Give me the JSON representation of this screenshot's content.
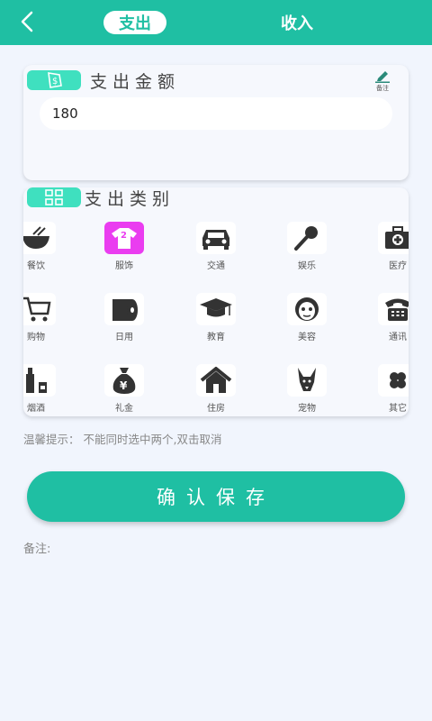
{
  "header": {
    "tabs": [
      {
        "label": "支出",
        "active": true
      },
      {
        "label": "收入",
        "active": false
      }
    ]
  },
  "amount_section": {
    "title": "支出金额",
    "remark_button_label": "备注",
    "input_value": "180"
  },
  "category_section": {
    "title": "支出类别",
    "items": [
      {
        "label": "餐饮",
        "icon": "bowl-icon",
        "selected": false
      },
      {
        "label": "服饰",
        "icon": "clothes-icon",
        "selected": true
      },
      {
        "label": "交通",
        "icon": "car-icon",
        "selected": false
      },
      {
        "label": "娱乐",
        "icon": "microphone-icon",
        "selected": false
      },
      {
        "label": "医疗",
        "icon": "medical-kit-icon",
        "selected": false
      },
      {
        "label": "购物",
        "icon": "shopping-cart-icon",
        "selected": false
      },
      {
        "label": "日用",
        "icon": "tissue-roll-icon",
        "selected": false
      },
      {
        "label": "教育",
        "icon": "graduation-cap-icon",
        "selected": false
      },
      {
        "label": "美容",
        "icon": "face-mask-icon",
        "selected": false
      },
      {
        "label": "通讯",
        "icon": "telephone-icon",
        "selected": false
      },
      {
        "label": "烟酒",
        "icon": "bottle-icon",
        "selected": false
      },
      {
        "label": "礼金",
        "icon": "money-bag-icon",
        "selected": false
      },
      {
        "label": "住房",
        "icon": "house-icon",
        "selected": false
      },
      {
        "label": "宠物",
        "icon": "dog-icon",
        "selected": false
      },
      {
        "label": "其它",
        "icon": "clover-icon",
        "selected": false
      }
    ]
  },
  "tip": "温馨提示： 不能同时选中两个,双击取消",
  "save_button_label": "确认保存",
  "note_label": "备注:",
  "colors": {
    "primary": "#1fbfa3",
    "badge": "#3fe0bf",
    "selected_category": "#ea3df0",
    "background": "#f1f5fd"
  }
}
